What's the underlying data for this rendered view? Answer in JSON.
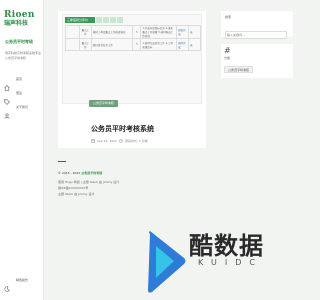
{
  "brand": {
    "logo_en": "Rioen",
    "logo_cn": "瑞声科技",
    "site_title": "公务员平时考核",
    "site_desc": "瑞声科技平时考核系统专注公务员平时考核"
  },
  "nav": {
    "home": "首页",
    "tags": "便签",
    "about": "关于我们"
  },
  "dark_mode": "暗色模式",
  "figure": {
    "header_title": "三季度积分评价",
    "rows": [
      {
        "c1": "",
        "c2": "重点工作",
        "c3": "做好三季度重点工作推进落实",
        "c4": "5",
        "c5": "1.完成年度目标任务 2.落实重点工作部署 3.按时报送工作情况",
        "c6": "提前完成",
        "c7": "无"
      },
      {
        "c1": "",
        "c2": "重点工作",
        "c3": "做好日常业务工作",
        "c4": "5",
        "c5": "1.按时完成日常工作 2.工作质量达标",
        "c6": "按时完成",
        "c7": "无"
      }
    ]
  },
  "article": {
    "tag": "公务员平时考核",
    "title": "公务员平时考核系统",
    "date": "Sep 25, 2022",
    "read_time": "阅读时长: 1 分钟"
  },
  "sidebar_right": {
    "search_label": "搜索",
    "search_placeholder": "输入关键词...",
    "tags_icon": "#",
    "tags_label": "分类",
    "tag_item": "公务员平时考核"
  },
  "footer": {
    "copyright_prefix": "© 2015 - 2022",
    "copyright_name": "公务员平时考核",
    "line1": "使用 Hugo 构建 | 主题 Stack 由 Jimmy 设计",
    "line2": "赣ICP备XXXXXXXX号",
    "line3": "主题 Stack 由 Jimmy 设计"
  },
  "watermark": {
    "cn": "酷数据",
    "en": "KUIDC"
  },
  "icons": {
    "home": "home-icon",
    "tags": "tag-icon",
    "about": "user-icon",
    "dark": "moon-icon",
    "calendar": "calendar-icon",
    "clock": "clock-icon",
    "play": "play-icon"
  },
  "colors": {
    "brand": "#2f8f4a",
    "chip": "#6aa37a",
    "watermark_blue": "#2f7bd8",
    "watermark_cyan": "#35c4e6"
  }
}
